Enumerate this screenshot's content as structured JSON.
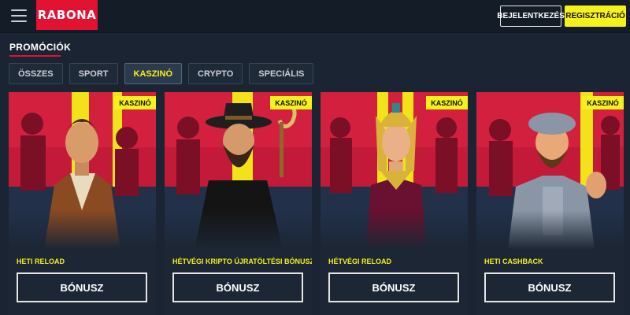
{
  "header": {
    "logo_text": "RABONA",
    "menu_icon": "hamburger-menu-icon",
    "login_label": "BEJELENTKEZÉS",
    "register_label": "REGISZTRÁCIÓ"
  },
  "page": {
    "title": "PROMÓCIÓK"
  },
  "tabs": [
    {
      "label": "ÖSSZES",
      "active": false
    },
    {
      "label": "SPORT",
      "active": false
    },
    {
      "label": "KASZINÓ",
      "active": true
    },
    {
      "label": "CRYPTO",
      "active": false
    },
    {
      "label": "SPECIÁLIS",
      "active": false
    }
  ],
  "cards": [
    {
      "tag": "KASZINÓ",
      "title": "HETI RELOAD",
      "button": "BÓNUSZ"
    },
    {
      "tag": "KASZINÓ",
      "title": "HÉTVÉGI KRIPTO ÚJRATÖLTÉSI BÓNUSZ",
      "button": "BÓNUSZ"
    },
    {
      "tag": "KASZINÓ",
      "title": "HÉTVÉGI RELOAD",
      "button": "BÓNUSZ"
    },
    {
      "tag": "KASZINÓ",
      "title": "HETI CASHBACK",
      "button": "BÓNUSZ"
    }
  ],
  "colors": {
    "accent_yellow": "#f5f21b",
    "brand_red": "#e21233",
    "background": "#1a2432"
  }
}
